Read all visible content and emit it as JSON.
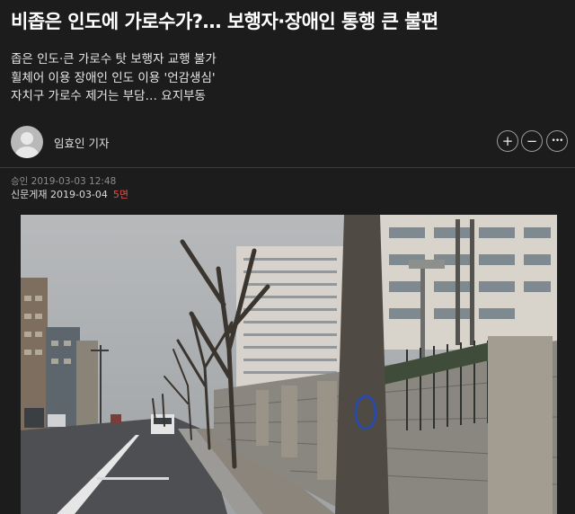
{
  "article": {
    "headline": "비좁은 인도에 가로수가?… 보행자·장애인 통행 큰 불편",
    "summary": [
      "좁은 인도·큰 가로수 탓 보행자 교행 불가",
      "휠체어 이용 장애인 인도 이용 '언감생심'",
      "자치구 가로수 제거는 부담… 요지부동"
    ],
    "author": "임효인 기자",
    "approved": "승인 2019-03-03 12:48",
    "print_date": "신문게재 2019-03-04",
    "print_page": "5면"
  },
  "actions": {
    "zoom_in": "+",
    "zoom_out": "−",
    "more": "•••"
  },
  "photo": {
    "subject": "street-with-trees-on-narrow-sidewalk"
  }
}
